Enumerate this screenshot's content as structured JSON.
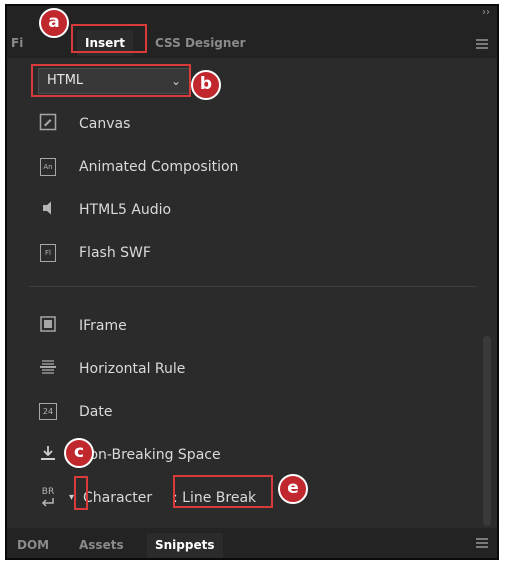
{
  "window": {
    "collapse_glyph": "››"
  },
  "tabs": [
    {
      "label": "Fi"
    },
    {
      "label": "Insert"
    },
    {
      "label": "CSS Designer"
    }
  ],
  "dropdown": {
    "selected": "HTML",
    "chevron": "⌄"
  },
  "items": [
    {
      "label": "Canvas",
      "icon": "canvas-icon"
    },
    {
      "label": "Animated Composition",
      "icon": "animated-composition-icon",
      "glyph": "An"
    },
    {
      "label": "HTML5 Audio",
      "icon": "audio-speaker-icon"
    },
    {
      "label": "Flash SWF",
      "icon": "flash-swf-icon",
      "glyph": "Fl"
    },
    {
      "label": "IFrame",
      "icon": "iframe-icon"
    },
    {
      "label": "Horizontal Rule",
      "icon": "horizontal-rule-icon"
    },
    {
      "label": "Date",
      "icon": "date-calendar-icon",
      "glyph": "24"
    },
    {
      "label": "Non-Breaking Space",
      "icon": "non-breaking-space-icon"
    },
    {
      "label": "Character",
      "suffix": ": Line Break",
      "icon": "line-break-icon",
      "glyph": "BR"
    }
  ],
  "bottom_tabs": [
    {
      "label": "DOM"
    },
    {
      "label": "Assets"
    },
    {
      "label": "Snippets"
    }
  ],
  "annotations": [
    {
      "letter": "a"
    },
    {
      "letter": "b"
    },
    {
      "letter": "c"
    },
    {
      "letter": "e"
    }
  ],
  "colors": {
    "highlight": "#d93a3a",
    "badge": "#c0282d",
    "panel": "#2b2b2b"
  }
}
